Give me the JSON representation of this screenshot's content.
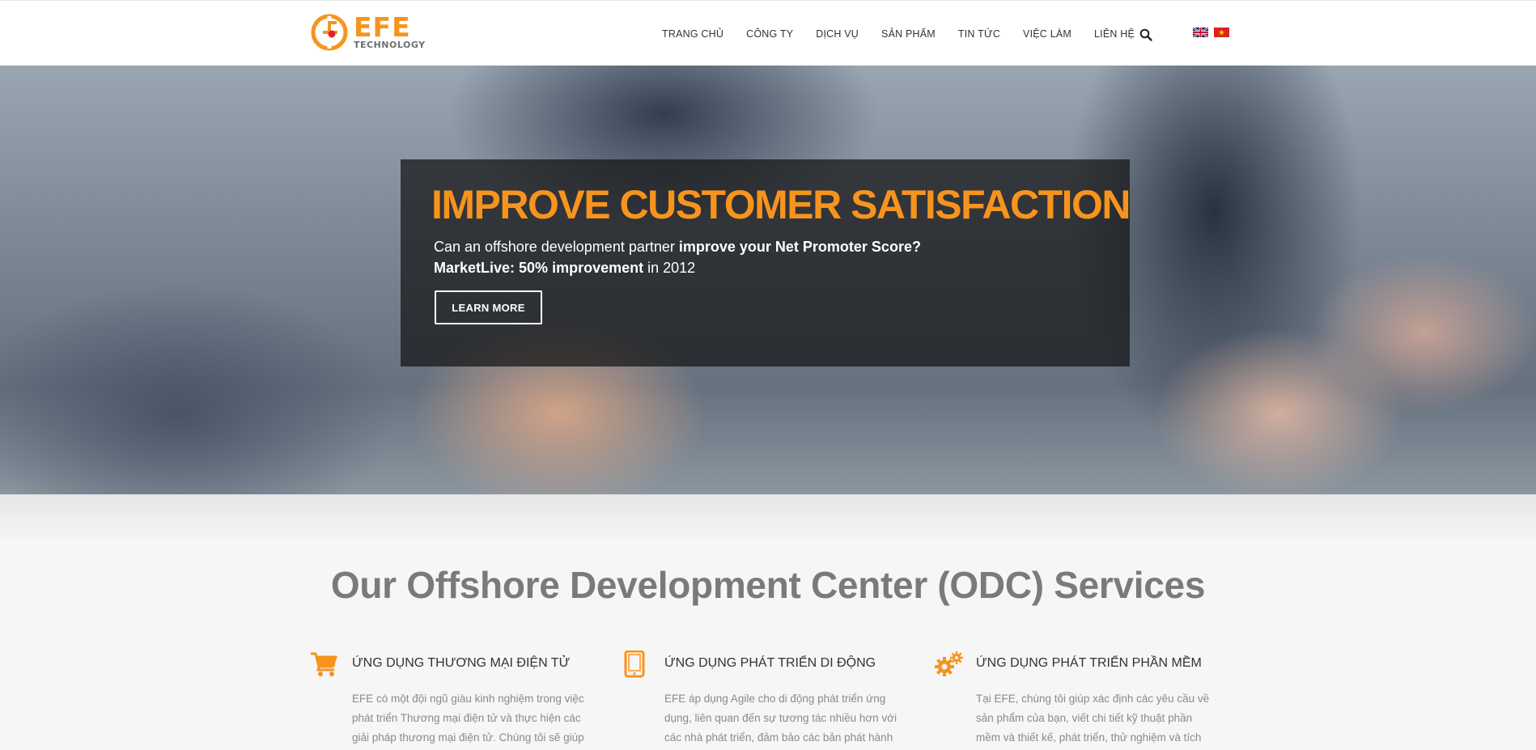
{
  "brand": {
    "name": "EFE",
    "tagline": "TECHNOLOGY",
    "accent_color": "#f7941d"
  },
  "nav": {
    "items": [
      "TRANG CHỦ",
      "CÔNG TY",
      "DỊCH VỤ",
      "SẢN PHẨM",
      "TIN TỨC",
      "VIỆC LÀM",
      "LIÊN HỆ"
    ],
    "search_icon": "search-icon",
    "languages": [
      "en-flag",
      "vn-flag"
    ]
  },
  "hero": {
    "title": "IMPROVE CUSTOMER SATISFACTION",
    "line1_normal": "Can an offshore development partner ",
    "line1_bold": "improve your Net Promoter Score?",
    "line2_bold": "MarketLive: 50% improvement",
    "line2_normal": " in 2012",
    "button_label": "LEARN MORE"
  },
  "services": {
    "heading": "Our Offshore Development Center (ODC) Services",
    "items": [
      {
        "icon": "shopping-cart-icon",
        "title": "ỨNG DỤNG THƯƠNG MẠI ĐIỆN TỬ",
        "desc": "EFE có một đội ngũ giàu kinh nghiệm trong việc phát triển Thương mại điện tử và thực hiện các giải pháp thương mại điện tử. Chúng tôi sẽ giúp"
      },
      {
        "icon": "mobile-icon",
        "title": "ỨNG DỤNG PHÁT TRIỂN DI ĐỘNG",
        "desc": "EFE áp dụng Agile cho di động phát triển ứng dụng, liên quan đến sự tương tác nhiều hơn với các nhà phát triển, đảm bảo các bản phát hành cuối cùng"
      },
      {
        "icon": "gears-icon",
        "title": "ỨNG DỤNG PHÁT TRIỂN PHẦN MỀM",
        "desc": "Tại EFE, chúng tôi giúp xác định các yêu cầu về sản phẩm của bạn, viết chi tiết kỹ thuật phần mềm và thiết kế, phát triển, thử nghiệm và tích hợp các"
      }
    ]
  }
}
